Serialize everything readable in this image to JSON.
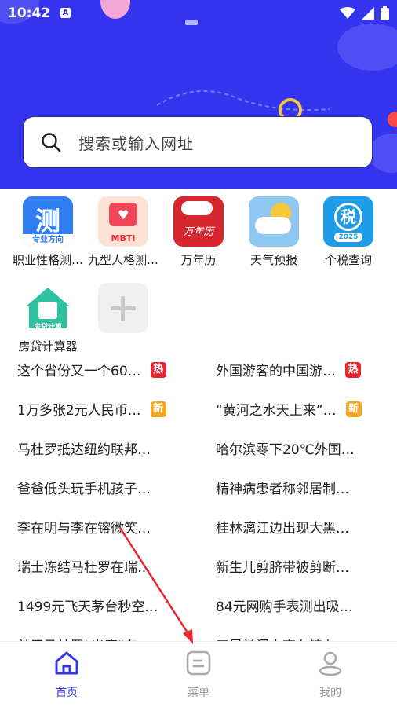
{
  "status_bar": {
    "time": "10:42",
    "notif_icon": "A"
  },
  "search": {
    "placeholder": "搜索或输入网址"
  },
  "apps": [
    {
      "label": "职业性格测…",
      "icon_text": "测",
      "icon_sub": "专业方向",
      "icon": "test-icon"
    },
    {
      "label": "九型人格测…",
      "icon_text": "MBTI",
      "icon": "mbti-icon"
    },
    {
      "label": "万年历",
      "icon_text": "万年历",
      "icon": "calendar-icon"
    },
    {
      "label": "天气预报",
      "icon": "weather-icon"
    },
    {
      "label": "个税查询",
      "icon_text": "税",
      "icon_sub": "2025",
      "icon": "tax-icon"
    },
    {
      "label": "房贷计算器",
      "icon_text": "房贷计算",
      "icon": "mortgage-icon"
    }
  ],
  "badges": {
    "hot": "热",
    "new": "新"
  },
  "news": [
    [
      {
        "text": "这个省份又一个60…",
        "badge": "hot"
      },
      {
        "text": "外国游客的中国游…",
        "badge": "hot"
      }
    ],
    [
      {
        "text": "1万多张2元人民币…",
        "badge": "new"
      },
      {
        "text": "“黄河之水天上来”…",
        "badge": "new"
      }
    ],
    [
      {
        "text": "马杜罗抵达纽约联邦…"
      },
      {
        "text": "哈尔滨零下20℃外国…"
      }
    ],
    [
      {
        "text": "爸爸低头玩手机孩子…"
      },
      {
        "text": "精神病患者称邻居制…"
      }
    ],
    [
      {
        "text": "李在明与李在镕微笑…"
      },
      {
        "text": "桂林漓江边出现大黑…"
      }
    ],
    [
      {
        "text": "瑞士冻结马杜罗在瑞…"
      },
      {
        "text": "新生儿剪脐带被剪断…"
      }
    ],
    [
      {
        "text": "1499元飞天茅台秒空…"
      },
      {
        "text": "84元网购手表测出吸…"
      }
    ],
    [
      {
        "text": "关于马杜罗“出庭”有…"
      },
      {
        "text": "三星掌门人李在镕在…"
      }
    ]
  ],
  "nav": [
    {
      "label": "首页",
      "active": true
    },
    {
      "label": "菜单",
      "active": false
    },
    {
      "label": "我的",
      "active": false
    }
  ],
  "colors": {
    "primary": "#3535f0",
    "hot": "#e8262f",
    "new": "#f5a623"
  }
}
